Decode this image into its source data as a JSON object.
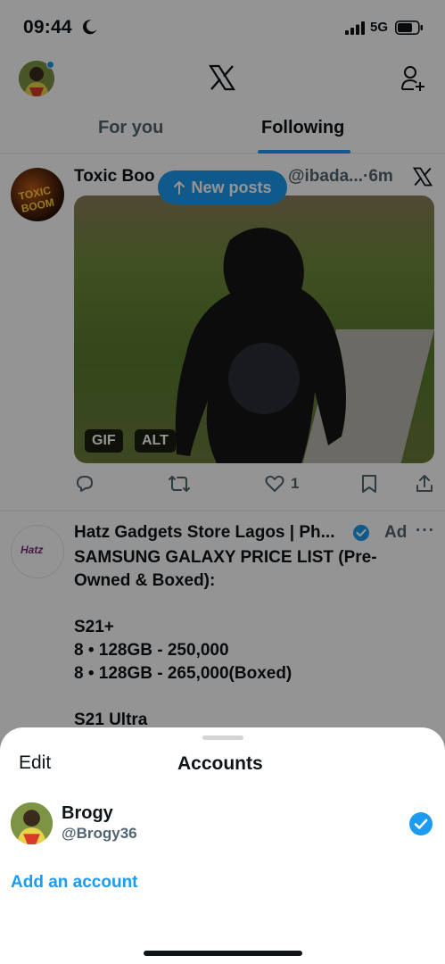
{
  "status_bar": {
    "time": "09:44",
    "network": "5G"
  },
  "header": {
    "avatar": "profile-avatar",
    "logo": "x-logo-icon",
    "follow_icon": "add-user-icon"
  },
  "tabs": [
    {
      "label": "For you",
      "active": false
    },
    {
      "label": "Following",
      "active": true
    }
  ],
  "new_posts": {
    "label": "New posts"
  },
  "tweet": {
    "name": "Toxic Boo",
    "handle": "@ibada...·6m",
    "media_badges": [
      "GIF",
      "ALT"
    ],
    "like_count": "1",
    "avatar_text": "TOXIC BOOM"
  },
  "ad": {
    "name": "Hatz Gadgets Store Lagos | Ph...",
    "label": "Ad",
    "more": "···",
    "avatar_text": "Hatz",
    "text": "SAMSUNG GALAXY PRICE LIST (Pre-Owned & Boxed):\n\nS21+\n8 • 128GB - 250,000\n8 • 128GB - 265,000(Boxed)\n\nS21 Ultra"
  },
  "sheet": {
    "edit_label": "Edit",
    "title": "Accounts",
    "account": {
      "name": "Brogy",
      "handle": "@Brogy36",
      "selected": true
    },
    "add_account_label": "Add an account"
  },
  "colors": {
    "accent": "#1d9bf0",
    "text": "#0f1419",
    "muted": "#536471"
  }
}
